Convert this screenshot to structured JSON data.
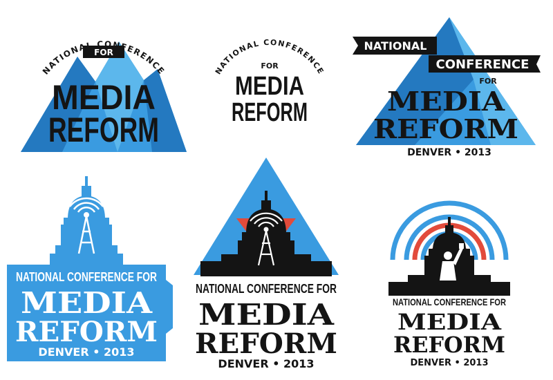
{
  "colors": {
    "blue": "#3a9be0",
    "blue_light": "#5cb7ec",
    "blue_dark": "#2479c0",
    "black": "#141414",
    "red": "#e24b3b",
    "white": "#ffffff"
  },
  "logos": [
    {
      "arc_text": "NATIONAL CONFERENCE",
      "for_label": "FOR",
      "line1": "MEDIA",
      "line2": "REFORM",
      "icon": "mountain-icon"
    },
    {
      "arc_text": "NATIONAL CONFERENCE",
      "for_label": "FOR",
      "line1": "MEDIA",
      "line2": "REFORM"
    },
    {
      "banner1": "NATIONAL",
      "banner2": "CONFERENCE",
      "for_label": "FOR",
      "line1": "MEDIA",
      "line2": "REFORM",
      "tagline": "DENVER • 2013",
      "icon": "mountain-icon"
    },
    {
      "header": "NATIONAL CONFERENCE FOR",
      "line1": "MEDIA",
      "line2": "REFORM",
      "tagline": "DENVER • 2013",
      "icon": "capitol-tower-icon"
    },
    {
      "header": "NATIONAL CONFERENCE FOR",
      "line1": "MEDIA",
      "line2": "REFORM",
      "tagline": "DENVER • 2013",
      "icon": "capitol-tower-icon"
    },
    {
      "header": "NATIONAL CONFERENCE FOR",
      "line1": "MEDIA",
      "line2": "REFORM",
      "tagline": "DENVER • 2013",
      "icon": "capitol-fist-icon"
    }
  ]
}
